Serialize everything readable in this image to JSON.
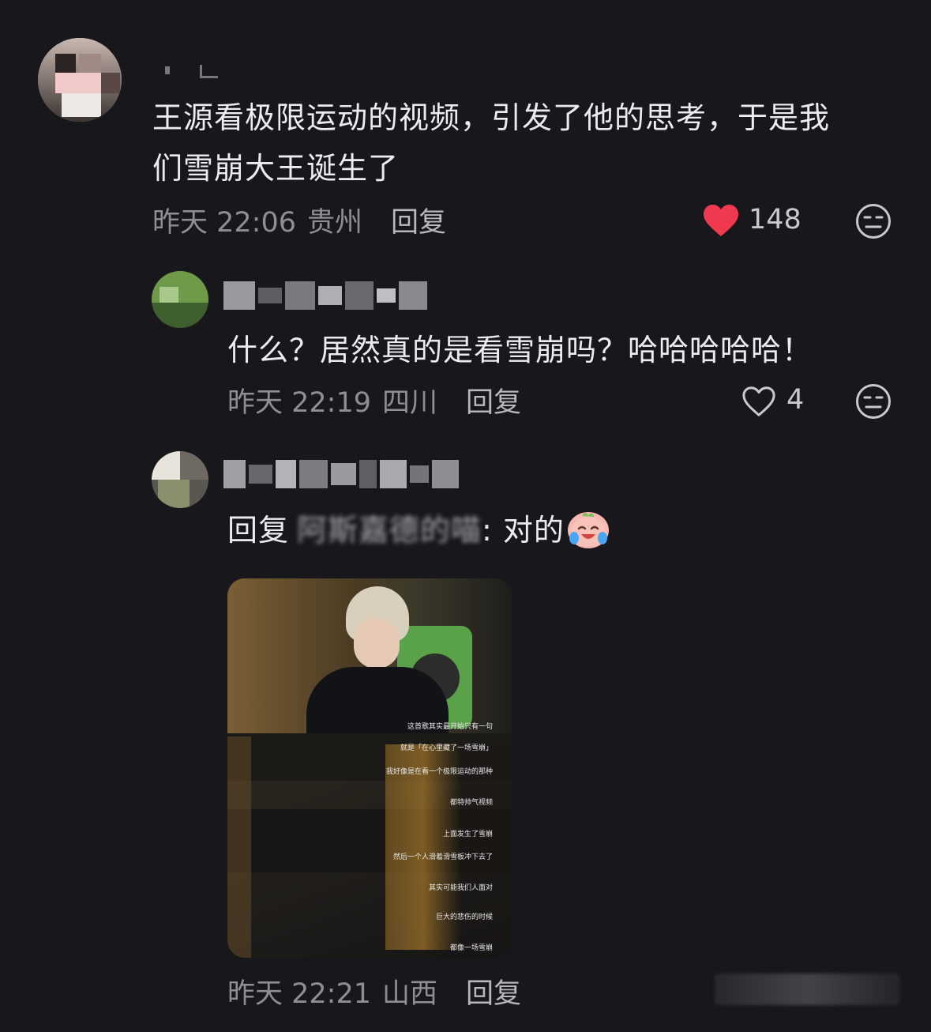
{
  "comments": [
    {
      "text_line1": "王源看极限运动的视频，引发了他的思考，于是我",
      "text_line2": "们雪崩大王诞生了",
      "time": "昨天 22:06",
      "location": "贵州",
      "reply_label": "回复",
      "likes": "148",
      "liked": true
    },
    {
      "text": "什么？居然真的是看雪崩吗？哈哈哈哈哈！",
      "time": "昨天 22:19",
      "location": "四川",
      "reply_label": "回复",
      "likes": "4",
      "liked": false
    },
    {
      "reply_prefix": "回复",
      "reply_to": "阿斯嘉德的喵",
      "text": ": 对的",
      "time": "昨天 22:21",
      "location": "山西",
      "reply_label": "回复"
    }
  ],
  "image_subtitles": [
    "这首歌其实最开始只有一句",
    "就是「在心里藏了一场雪崩」",
    "我好像是在看一个极限运动的那种",
    "都特帅气视频",
    "上面发生了雪崩",
    "然后一个人滑着滑雪板冲下去了",
    "其实可能我们人面对",
    "巨大的悲伤的时候",
    "都像一场雪崩"
  ],
  "colors": {
    "background": "#18171c",
    "like_active": "#f0384e",
    "meta": "#8e8e94"
  },
  "icons": [
    "heart-filled-icon",
    "heart-outline-icon",
    "emoji-face-icon",
    "laughing-tears-emoji"
  ]
}
